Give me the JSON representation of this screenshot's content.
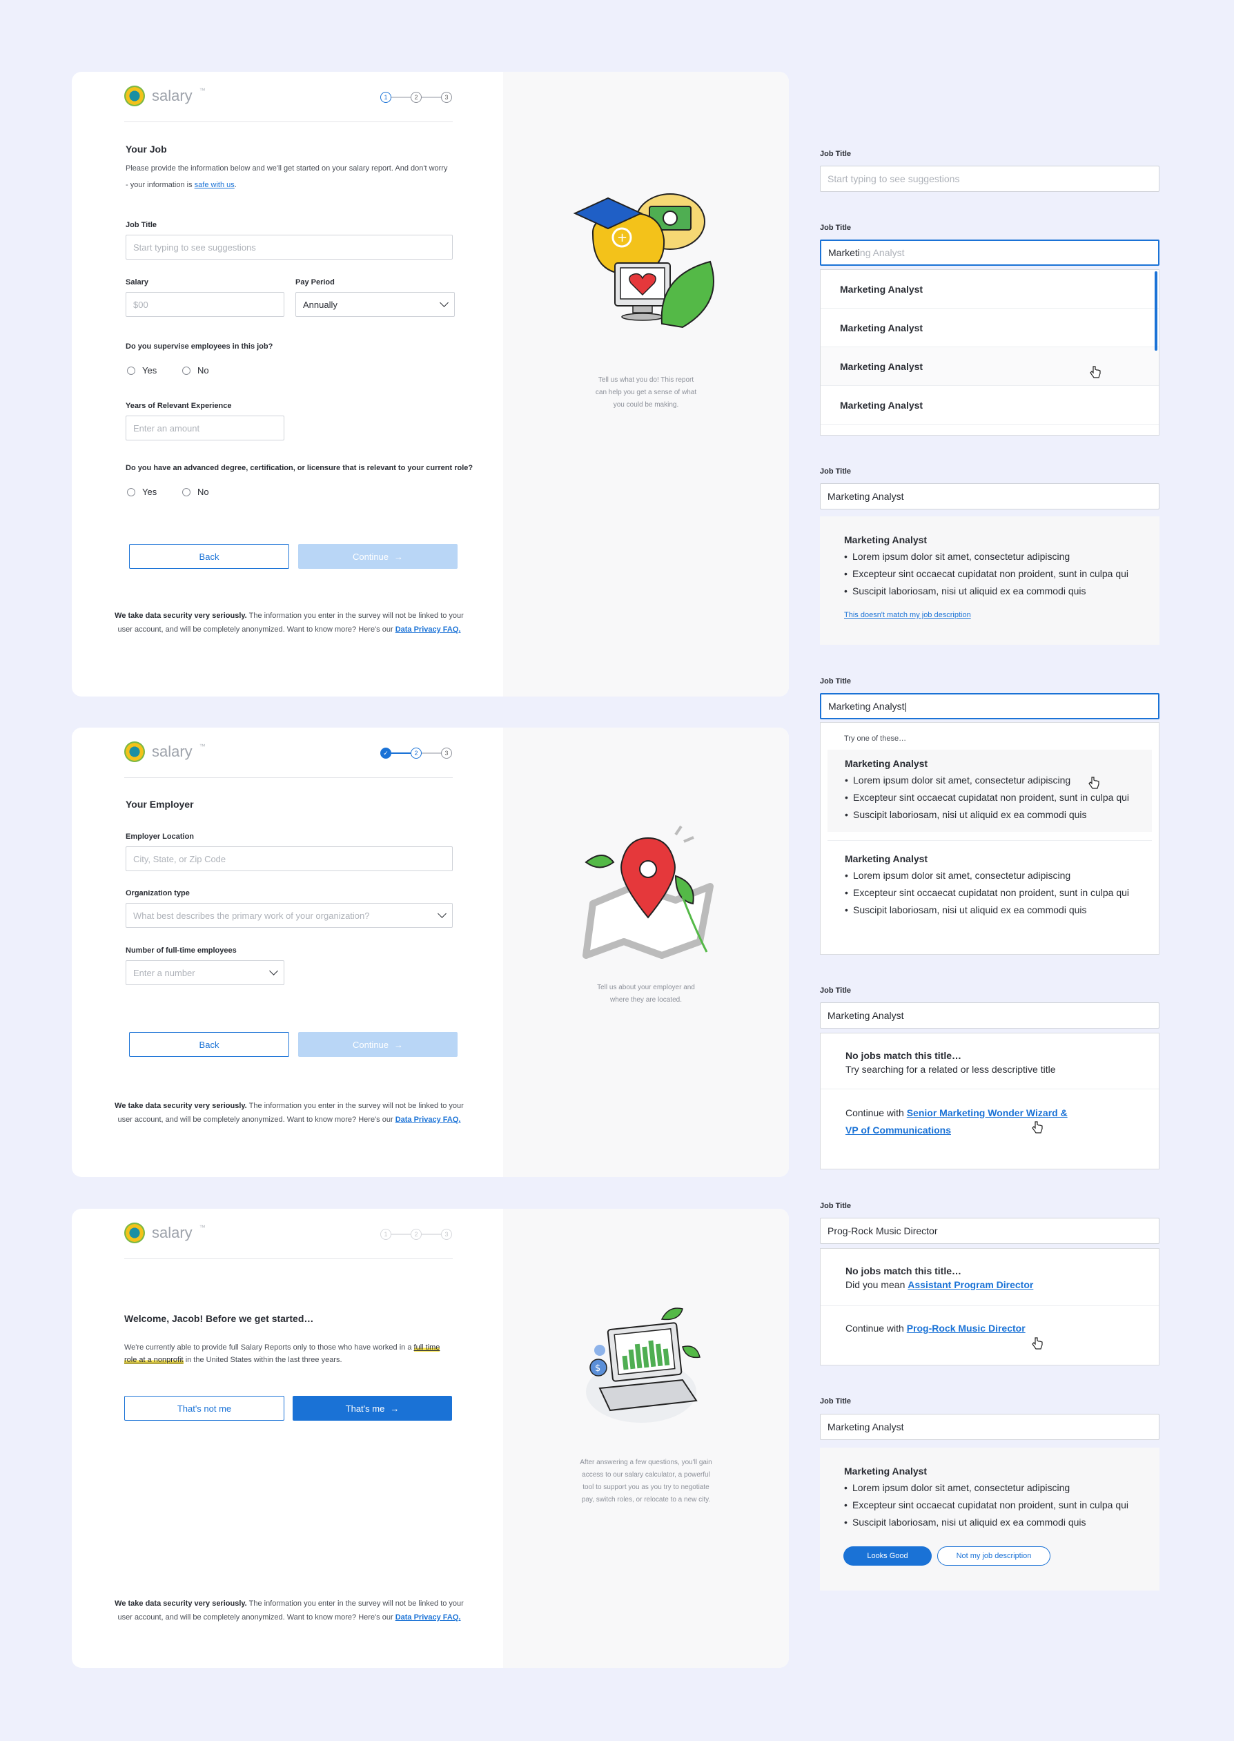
{
  "brand": {
    "name": "salary",
    "tm": "™"
  },
  "screen1": {
    "steps": [
      "1",
      "2",
      "3"
    ],
    "title": "Your Job",
    "intro_text": "Please provide the information below and we'll get started on your salary report. And don't worry - your information is",
    "intro_link": "safe with us",
    "intro_end": ".",
    "job_title_label": "Job Title",
    "job_title_placeholder": "Start typing to see suggestions",
    "salary_label": "Salary",
    "salary_placeholder": "$00",
    "pay_period_label": "Pay Period",
    "pay_period_value": "Annually",
    "supervise_q": "Do you supervise employees in this job?",
    "yes": "Yes",
    "no": "No",
    "experience_label": "Years of Relevant Experience",
    "experience_placeholder": "Enter an amount",
    "degree_q": "Do you have an advanced degree, certification, or licensure that is relevant to your current role?",
    "back": "Back",
    "continue": "Continue",
    "footer_bold": "We take data security very seriously.",
    "footer_text": "The information you enter in the survey will not be linked to your user account, and will be completely anonymized. Want to know more? Here's our",
    "footer_link": "Data Privacy FAQ.",
    "caption": "Tell us what you do! This report can help you get a sense of what you could be making."
  },
  "screen2": {
    "title": "Your Employer",
    "location_label": "Employer Location",
    "location_placeholder": "City, State, or Zip Code",
    "org_label": "Organization type",
    "org_placeholder": "What best describes the primary work of your organization?",
    "employees_label": "Number of full-time employees",
    "employees_placeholder": "Enter a number",
    "back": "Back",
    "continue": "Continue",
    "footer_bold": "We take data security very seriously.",
    "footer_text": "The information you enter in the survey will not be linked to your user account, and will be completely anonymized. Want to know more? Here's our",
    "footer_link": "Data Privacy FAQ.",
    "caption": "Tell us about your employer and where they are located."
  },
  "screen3": {
    "title": "Welcome, Jacob! Before we get started…",
    "body_start": "We're currently able to provide full Salary Reports only to those who have worked in a",
    "highlight": "full time role at a nonprofit",
    "body_end": "in the United States within the last three years.",
    "not_me": "That's not me",
    "is_me": "That's me",
    "footer_bold": "We take data security very seriously.",
    "footer_text": "The information you enter in the survey will not be linked to your user account, and will be completely anonymized. Want to know more? Here's our",
    "footer_link": "Data Privacy FAQ.",
    "caption": "After answering a few questions, you'll gain access to our salary calculator, a powerful tool to support you as you try to negotiate pay, switch roles, or relocate to a new city."
  },
  "states": {
    "label": "Job Title",
    "s1_placeholder": "Start typing to see suggestions",
    "s2_typed": "Marketi",
    "s2_suggest": "ng Analyst",
    "s2_items": [
      "Marketing Analyst",
      "Marketing Analyst",
      "Marketing Analyst",
      "Marketing Analyst"
    ],
    "s3_value": "Marketing Analyst",
    "s3_desc_title": "Marketing Analyst",
    "bullets": [
      "Lorem ipsum dolor sit amet, consectetur adipiscing",
      "Excepteur sint occaecat cupidatat non proident, sunt in culpa qui",
      "Suscipit laboriosam, nisi ut aliquid ex ea commodi quis"
    ],
    "s3_link": "This doesn't match my job description",
    "s4_value": "Marketing Analyst|",
    "s4_try": "Try one of these…",
    "s4_opt_title": "Marketing Analyst",
    "s5_value": "Marketing Analyst",
    "s5_nomatch": "No jobs match this title…",
    "s5_hint": "Try searching for a related or less descriptive title",
    "s5_continue": "Continue with",
    "s5_link": "Senior Marketing Wonder Wizard & VP of Communications",
    "s6_value": "Prog-Rock Music Director",
    "s6_nomatch": "No jobs match this title…",
    "s6_didyou": "Did you mean",
    "s6_suggest": "Assistant Program Director",
    "s6_continue": "Continue with",
    "s6_link": "Prog-Rock Music Director",
    "s7_value": "Marketing Analyst",
    "s7_desc_title": "Marketing Analyst",
    "looks_good": "Looks Good",
    "not_mine": "Not my job description"
  },
  "colors": {
    "background": "#eef0fc",
    "accent": "#1a72d6",
    "disabled": "#b9d6f6",
    "highlight": "#f8e34a"
  }
}
